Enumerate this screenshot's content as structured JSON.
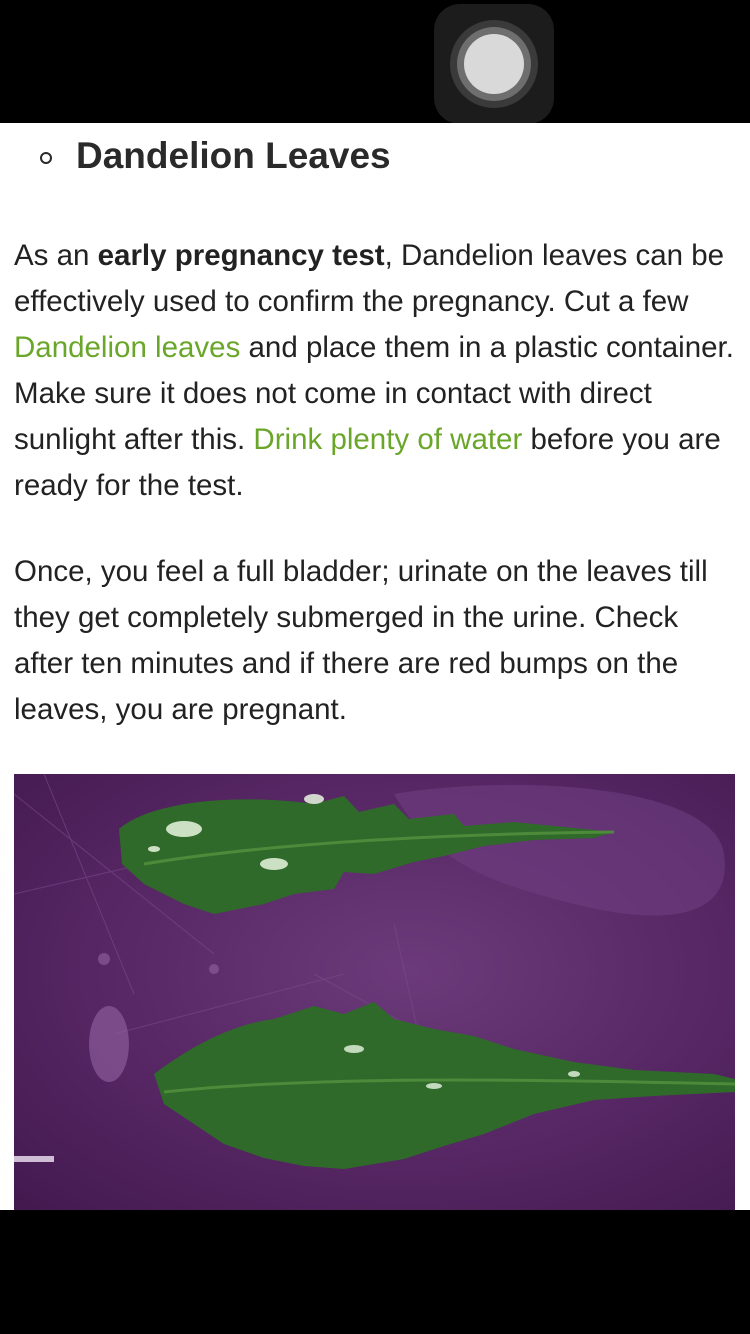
{
  "article": {
    "heading": "Dandelion Leaves",
    "paragraph1": {
      "t1": "As an ",
      "bold": "early pregnancy test",
      "t2": ", Dandelion leaves can be effectively used to confirm the pregnancy. Cut a few ",
      "link1": "Dandelion leaves",
      "t3": " and place them in a plastic container. Make sure it does not come in contact with direct sunlight after this. ",
      "link2": "Drink plenty of water",
      "t4": " before you are ready for the test."
    },
    "paragraph2": "Once, you feel a full bladder; urinate on the leaves till they get completely submerged in the urine. Check after ten minutes and if there are red bumps on the leaves, you are pregnant."
  },
  "colors": {
    "link": "#6aa62a",
    "text": "#222222",
    "background": "#ffffff",
    "photo_background": "#5a2a68",
    "leaf": "#2f6a2a"
  },
  "icons": {
    "assistive_touch": "assistive-touch-icon",
    "bullet": "hollow-circle-bullet"
  }
}
